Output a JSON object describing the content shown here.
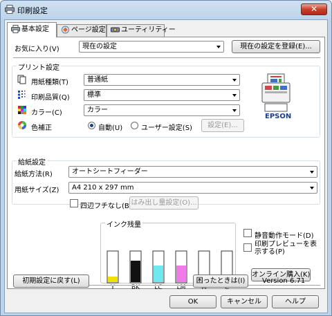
{
  "window": {
    "title": "印刷設定",
    "close_label": "✕"
  },
  "tabs": [
    {
      "label": "基本設定"
    },
    {
      "label": "ページ設定"
    },
    {
      "label": "ユーティリティー"
    }
  ],
  "favorites": {
    "label": "お気に入り(V)",
    "value": "現在の設定",
    "register_button": "現在の設定を登録(E)..."
  },
  "print_settings": {
    "title": "プリント設定",
    "paper_type": {
      "label": "用紙種類(T)",
      "value": "普通紙"
    },
    "print_quality": {
      "label": "印刷品質(Q)",
      "value": "標準"
    },
    "color": {
      "label": "カラー(C)",
      "value": "カラー"
    },
    "color_correction": {
      "label": "色補正",
      "auto_label": "自動(U)",
      "user_label": "ユーザー設定(S)",
      "settings_button": "設定(E)..."
    },
    "brand": "EPSON"
  },
  "paper_feed": {
    "title": "給紙設定",
    "source": {
      "label": "給紙方法(R)",
      "value": "オートシートフィーダー"
    },
    "size": {
      "label": "用紙サイズ(Z)",
      "value": "A4 210 x 297 mm"
    },
    "borderless_label": "四辺フチなし(B)",
    "overflow_button": "はみ出し量設定(O)..."
  },
  "ink": {
    "title": "インク残量",
    "levels": [
      {
        "name": "Y",
        "color": "#f0e000",
        "level": 0.18
      },
      {
        "name": "BK",
        "color": "#111111",
        "level": 0.7
      },
      {
        "name": "LC",
        "color": "#6fe8f0",
        "level": 0.55
      },
      {
        "name": "LM",
        "color": "#f07ae8",
        "level": 0.55
      },
      {
        "name": "M",
        "color": "#e030d0",
        "level": 0.2
      },
      {
        "name": "C",
        "color": "#30c8e8",
        "level": 0.15
      }
    ]
  },
  "options": {
    "quiet_mode_label": "静音動作モード(D)",
    "preview_label": "印刷プレビューを表示する(P)",
    "online_buy_button": "オンライン購入(K)"
  },
  "footer": {
    "reset_button": "初期設定に戻す(L)",
    "help_trouble_button": "困ったときは(I)",
    "version": "Version 6.71"
  },
  "dialog": {
    "ok": "OK",
    "cancel": "キャンセル",
    "help": "ヘルプ"
  }
}
